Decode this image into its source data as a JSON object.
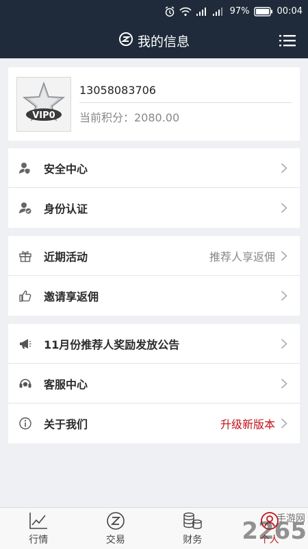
{
  "status_bar": {
    "time": "00:04",
    "battery": "97%",
    "icons": [
      "alarm-icon",
      "wifi-icon",
      "signal-3g-icon",
      "signal-2g-icon",
      "battery-icon"
    ]
  },
  "header": {
    "title": "我的信息",
    "menu_icon": "list-menu-icon"
  },
  "profile": {
    "avatar_badge": "VIP0",
    "phone": "13058083706",
    "points_label": "当前积分：2080.00"
  },
  "groups": [
    [
      {
        "label": "安全中心",
        "icon": "shield-user-icon"
      },
      {
        "label": "身份认证",
        "icon": "verified-user-icon"
      }
    ],
    [
      {
        "label": "近期活动",
        "icon": "gift-icon",
        "right": "推荐人享返佣"
      },
      {
        "label": "邀请享返佣",
        "icon": "thumbs-up-icon"
      }
    ],
    [
      {
        "label": "11月份推荐人奖励发放公告",
        "icon": "megaphone-icon"
      },
      {
        "label": "客服中心",
        "icon": "headset-icon"
      },
      {
        "label": "关于我们",
        "icon": "info-icon",
        "right": "升级新版本",
        "right_color": "#c0121a"
      }
    ]
  ],
  "tabbar": [
    {
      "label": "行情",
      "icon": "chart-icon"
    },
    {
      "label": "交易",
      "icon": "exchange-icon"
    },
    {
      "label": "财务",
      "icon": "coins-icon"
    },
    {
      "label": "个人",
      "icon": "person-icon",
      "active": true
    }
  ],
  "watermark": {
    "text": "2265",
    "sub": "手游网"
  },
  "colors": {
    "header_bg": "#1f2b3a",
    "accent_red": "#c0121a",
    "page_bg": "#eef0f3"
  }
}
